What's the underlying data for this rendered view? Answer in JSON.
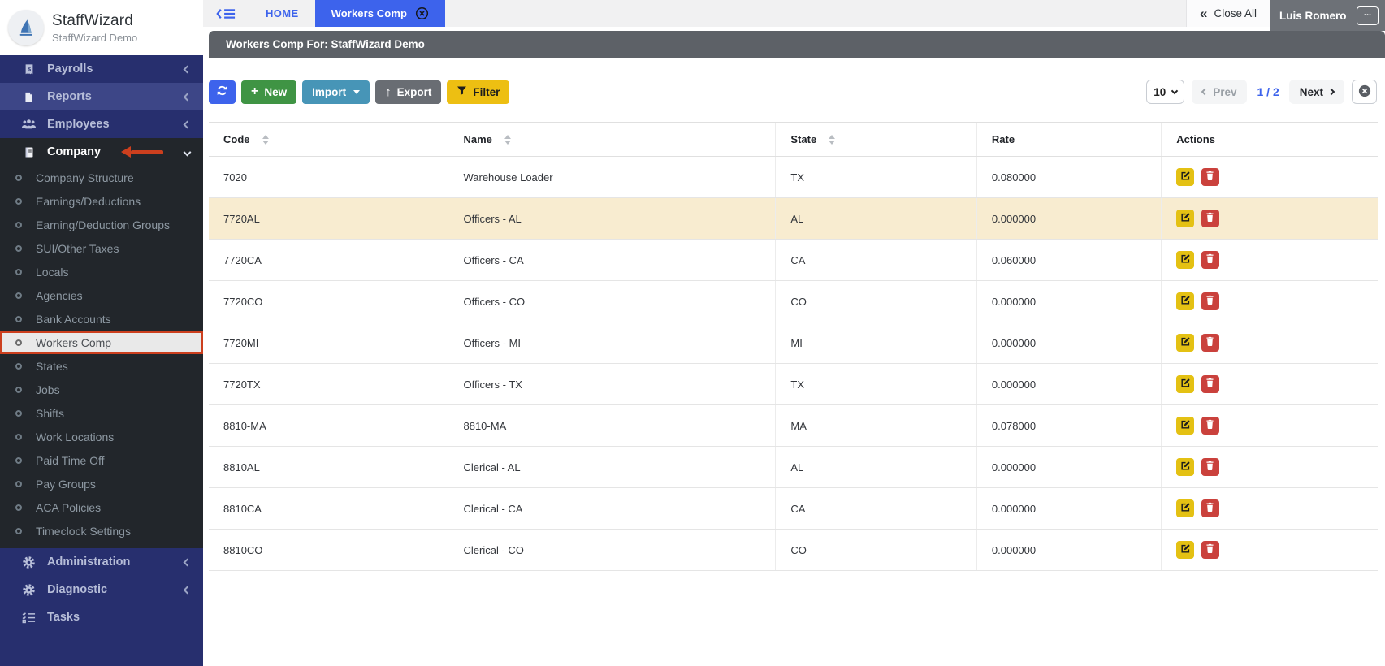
{
  "colors": {
    "accent_blue": "#3d63ec",
    "sidebar_blue": "#272f6e",
    "sidebar_blue_lit": "#3d4687",
    "sidebar_dark": "#22262b",
    "highlight_row": "#f8ecd0",
    "active_item_border": "#cc3f1e",
    "btn_new_green": "#3f9444",
    "btn_import_teal": "#4795b7",
    "btn_export_gray": "#696d73",
    "btn_filter_yellow": "#edbf12",
    "btn_edit_yellow": "#e4c113",
    "btn_delete_red": "#ca413c",
    "header_bar_gray": "#5d6167",
    "user_box_gray": "#6d7177"
  },
  "sidebar": {
    "title": "StaffWizard",
    "subtitle": "StaffWizard Demo",
    "payrolls": "Payrolls",
    "reports": "Reports",
    "employees": "Employees",
    "company": "Company",
    "company_submenu": [
      "Company Structure",
      "Earnings/Deductions",
      "Earning/Deduction Groups",
      "SUI/Other Taxes",
      "Locals",
      "Agencies",
      "Bank Accounts",
      "Workers Comp",
      "States",
      "Jobs",
      "Shifts",
      "Work Locations",
      "Paid Time Off",
      "Pay Groups",
      "ACA Policies",
      "Timeclock Settings"
    ],
    "active_submenu_item": "Workers Comp",
    "administration": "Administration",
    "diagnostic": "Diagnostic",
    "tasks": "Tasks"
  },
  "topbar": {
    "home_tab": "HOME",
    "active_tab": "Workers Comp",
    "close_all_label": "Close All",
    "user_name": "Luis Romero",
    "more_label": "..."
  },
  "page_header": {
    "title": "Workers Comp For: StaffWizard Demo"
  },
  "toolbar": {
    "new_label": "New",
    "import_label": "Import",
    "export_label": "Export",
    "filter_label": "Filter"
  },
  "pagination": {
    "page_size": "10",
    "prev_label": "Prev",
    "page_indicator": "1 / 2",
    "next_label": "Next"
  },
  "table": {
    "columns": [
      {
        "label": "Code",
        "sortable": true
      },
      {
        "label": "Name",
        "sortable": true
      },
      {
        "label": "State",
        "sortable": true
      },
      {
        "label": "Rate",
        "sortable": false
      },
      {
        "label": "Actions",
        "sortable": false
      }
    ],
    "rows": [
      {
        "code": "7020",
        "name": "Warehouse Loader",
        "state": "TX",
        "rate": "0.080000",
        "highlighted": false
      },
      {
        "code": "7720AL",
        "name": "Officers - AL",
        "state": "AL",
        "rate": "0.000000",
        "highlighted": true
      },
      {
        "code": "7720CA",
        "name": "Officers - CA",
        "state": "CA",
        "rate": "0.060000",
        "highlighted": false
      },
      {
        "code": "7720CO",
        "name": "Officers - CO",
        "state": "CO",
        "rate": "0.000000",
        "highlighted": false
      },
      {
        "code": "7720MI",
        "name": "Officers - MI",
        "state": "MI",
        "rate": "0.000000",
        "highlighted": false
      },
      {
        "code": "7720TX",
        "name": "Officers - TX",
        "state": "TX",
        "rate": "0.000000",
        "highlighted": false
      },
      {
        "code": "8810-MA",
        "name": "8810-MA",
        "state": "MA",
        "rate": "0.078000",
        "highlighted": false
      },
      {
        "code": "8810AL",
        "name": "Clerical - AL",
        "state": "AL",
        "rate": "0.000000",
        "highlighted": false
      },
      {
        "code": "8810CA",
        "name": "Clerical - CA",
        "state": "CA",
        "rate": "0.000000",
        "highlighted": false
      },
      {
        "code": "8810CO",
        "name": "Clerical - CO",
        "state": "CO",
        "rate": "0.000000",
        "highlighted": false
      }
    ]
  }
}
